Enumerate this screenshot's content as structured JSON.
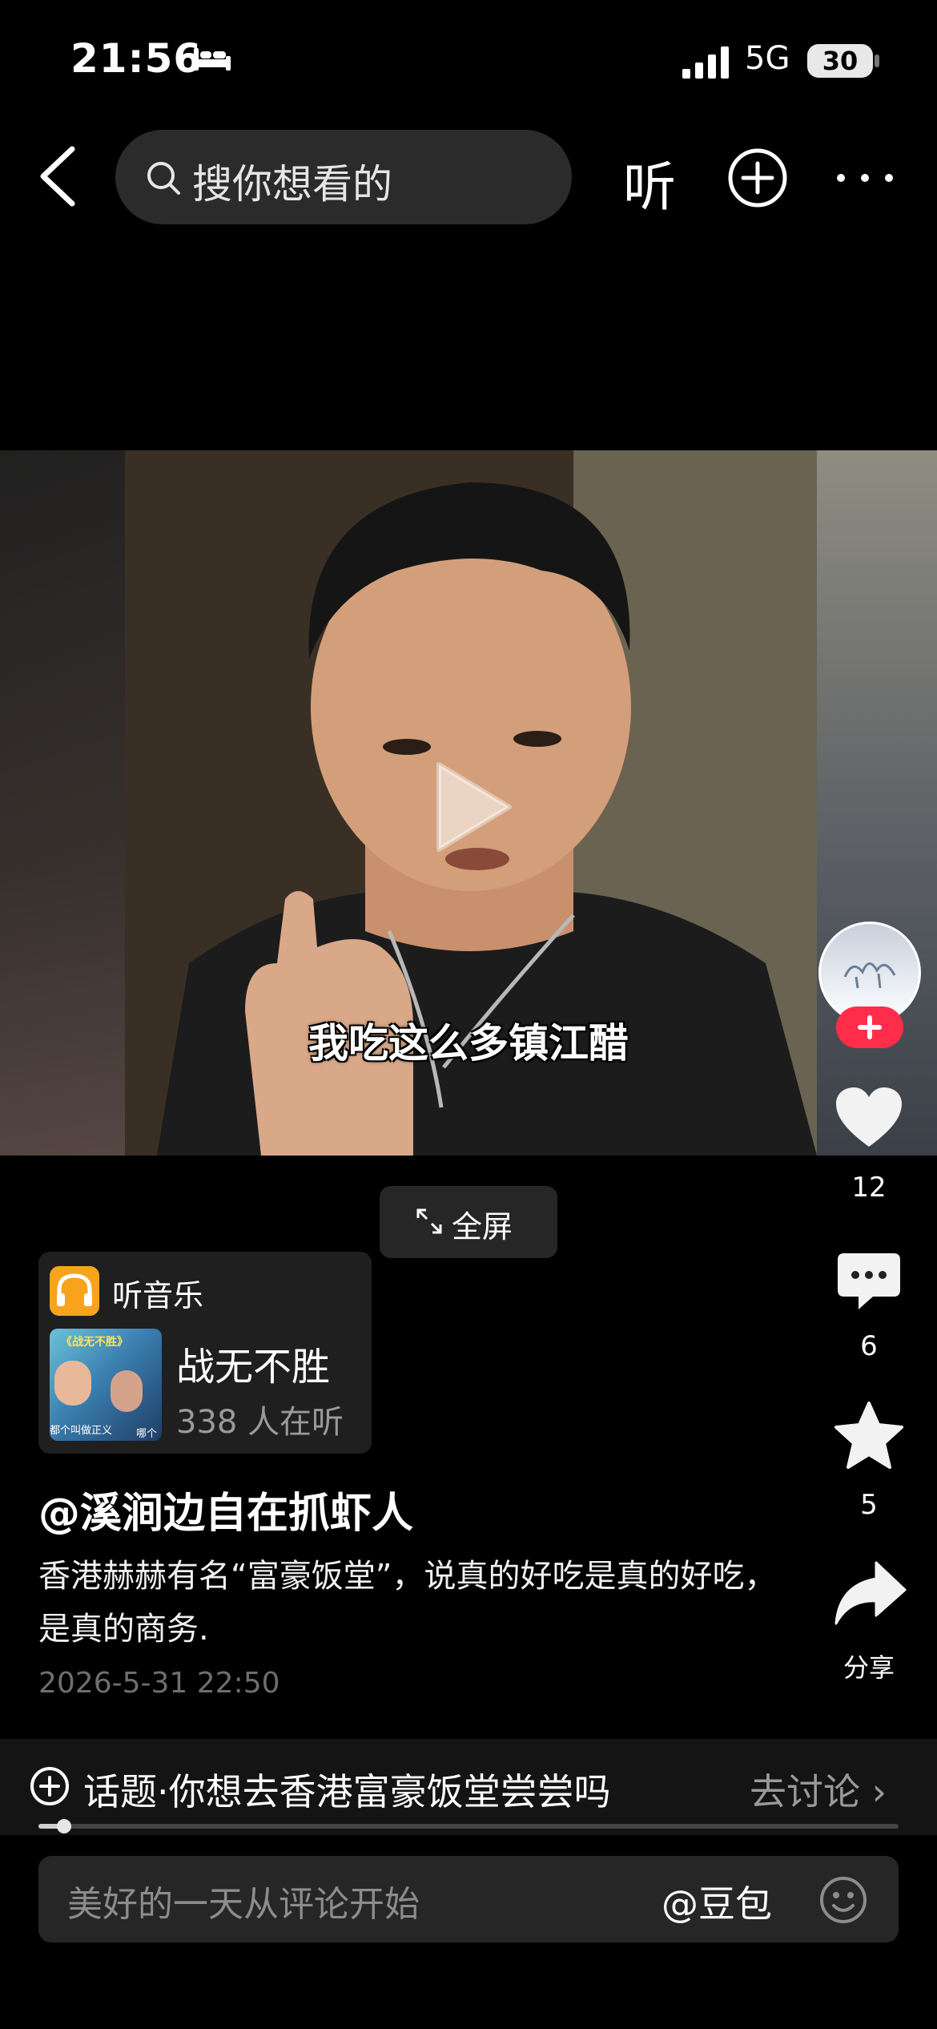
{
  "status_bar": {
    "time": "21:56",
    "network": "5G",
    "battery": "30"
  },
  "top_nav": {
    "search_placeholder": "搜你想看的",
    "listen_label": "听",
    "icons": [
      "back-icon",
      "search-icon",
      "add-icon",
      "more-icon"
    ]
  },
  "video": {
    "subtitle": "我吃这么多镇江醋",
    "fullscreen_label": "全屏"
  },
  "actions": {
    "likes": "12",
    "comments": "6",
    "favorites": "5",
    "share_label": "分享",
    "follow_color": "#ff2d4a"
  },
  "music": {
    "header": "听音乐",
    "song_title": "战无不胜",
    "listeners": "338 人在听",
    "cover_title": "《战无不胜》",
    "cover_foot_left": "都个叫做正义",
    "cover_foot_right": "哪个",
    "badge_color": "#f7a31c"
  },
  "post": {
    "author": "@溪涧边自在抓虾人",
    "description": "香港赫赫有名“富豪饭堂”，说真的好吃是真的好吃，是真的商务.",
    "date": "2026-5-31 22:50"
  },
  "topic": {
    "text": "话题·你想去香港富豪饭堂尝尝吗",
    "link": "去讨论 ›",
    "progress": 0.03
  },
  "comment_bar": {
    "placeholder": "美好的一天从评论开始",
    "mention": "@豆包"
  }
}
